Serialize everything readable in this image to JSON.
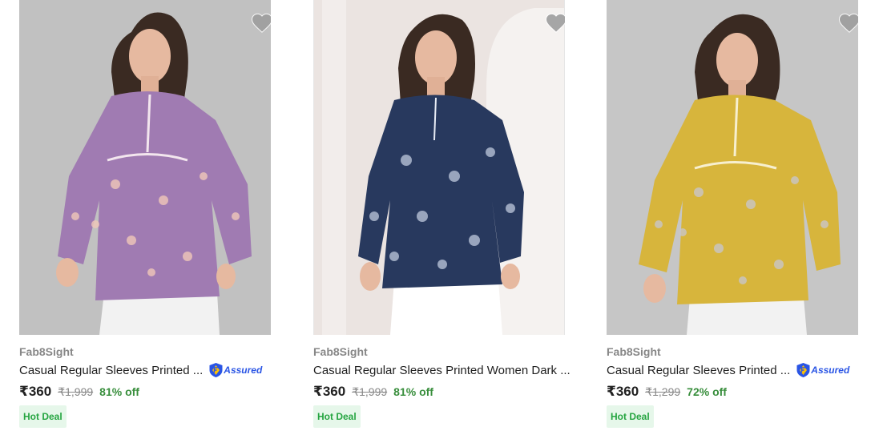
{
  "colors": {
    "brand_text": "#878787",
    "title_text": "#212121",
    "discount_green": "#388e3c",
    "deal_bg": "#e6f7ea",
    "deal_text": "#26a541",
    "assured_blue": "#2a55e5",
    "wishlist_gray": "#9e9e9e"
  },
  "products": [
    {
      "brand": "Fab8Sight",
      "title": "Casual Regular Sleeves Printed ...",
      "assured_label": "Assured",
      "price": "₹360",
      "mrp": "₹1,999",
      "discount": "81% off",
      "deal": "Hot Deal",
      "image_bg": "#c9c9c9",
      "garment_color": "#a07bb2",
      "wishlist_icon": "heart-icon"
    },
    {
      "brand": "Fab8Sight",
      "title": "Casual Regular Sleeves Printed Women Dark ...",
      "price": "₹360",
      "mrp": "₹1,999",
      "discount": "81% off",
      "deal": "Hot Deal",
      "image_bg": "#ebe4e1",
      "garment_color": "#28395e",
      "wishlist_icon": "heart-icon"
    },
    {
      "brand": "Fab8Sight",
      "title": "Casual Regular Sleeves Printed ...",
      "assured_label": "Assured",
      "price": "₹360",
      "mrp": "₹1,299",
      "discount": "72% off",
      "deal": "Hot Deal",
      "image_bg": "#c6c6c6",
      "garment_color": "#d7b53c",
      "wishlist_icon": "heart-icon"
    }
  ]
}
